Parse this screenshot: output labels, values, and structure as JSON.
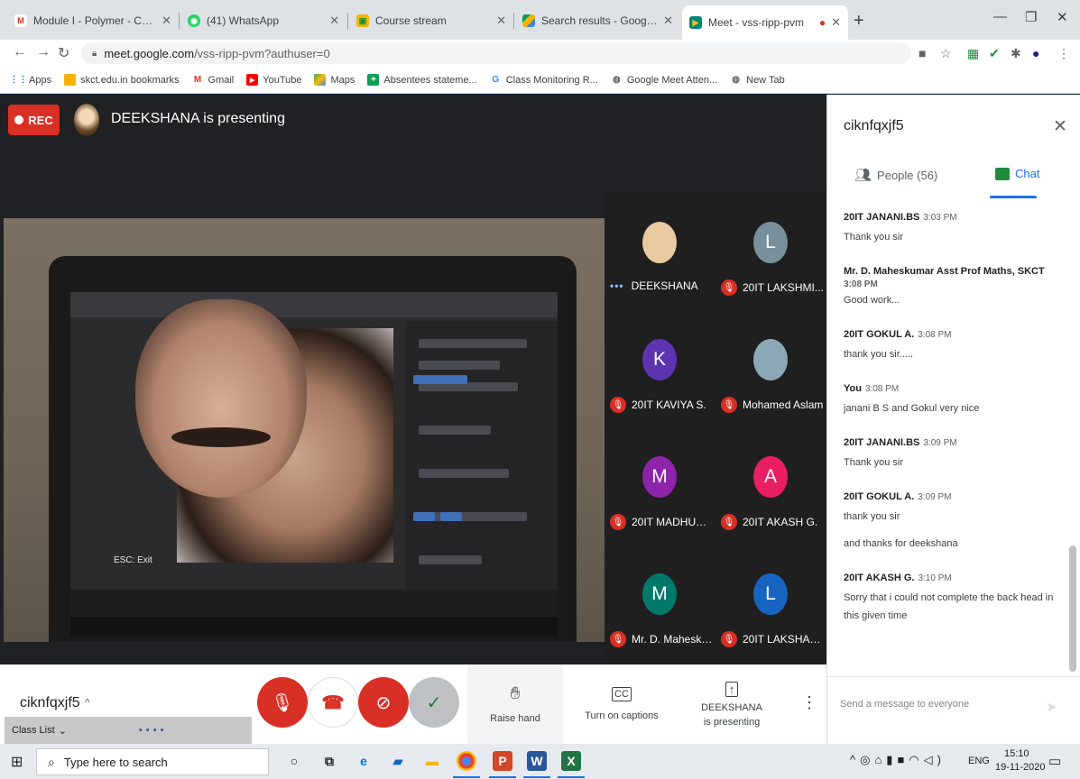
{
  "browser": {
    "tabs": [
      {
        "title": "Module I - Polymer - Corrected f",
        "icon": "gmail-icon"
      },
      {
        "title": "(41) WhatsApp",
        "icon": "whatsapp-icon"
      },
      {
        "title": "Course stream",
        "icon": "classroom-icon"
      },
      {
        "title": "Search results - Google Drive",
        "icon": "drive-icon"
      },
      {
        "title": "Meet - vss-ripp-pvm",
        "icon": "meet-icon"
      }
    ],
    "url_host": "meet.google.com",
    "url_path": "/vss-ripp-pvm?authuser=0",
    "bookmarks": [
      {
        "label": "Apps",
        "icon": "apps-grid-icon"
      },
      {
        "label": "skct.edu.in bookmarks",
        "icon": "folder-icon"
      },
      {
        "label": "Gmail",
        "icon": "gmail-icon"
      },
      {
        "label": "YouTube",
        "icon": "youtube-icon"
      },
      {
        "label": "Maps",
        "icon": "maps-icon"
      },
      {
        "label": "Absentees stateme...",
        "icon": "sheets-icon"
      },
      {
        "label": "Class Monitoring R...",
        "icon": "google-icon"
      },
      {
        "label": "Google Meet Atten...",
        "icon": "globe-icon"
      },
      {
        "label": "New Tab",
        "icon": "globe-icon"
      }
    ]
  },
  "meet": {
    "rec_label": "REC",
    "presenting_banner": "DEEKSHANA is presenting",
    "video_overlay_text": "ESC: Exit",
    "tiles": [
      {
        "name": "DEEKSHANA",
        "initial": "",
        "color": "#e8c9a0",
        "muted": false
      },
      {
        "name": "20IT LAKSHMI...",
        "initial": "L",
        "color": "#78909c",
        "muted": true
      },
      {
        "name": "20IT KAVIYA S.",
        "initial": "K",
        "color": "#5e35b1",
        "muted": true
      },
      {
        "name": "Mohamed Aslam",
        "initial": "",
        "color": "#8da9b8",
        "muted": true
      },
      {
        "name": "20IT MADHUMI...",
        "initial": "M",
        "color": "#8e24aa",
        "muted": true
      },
      {
        "name": "20IT AKASH G.",
        "initial": "A",
        "color": "#e91e63",
        "muted": true
      },
      {
        "name": "Mr. D. Mahesku...",
        "initial": "M",
        "color": "#00796b",
        "muted": true
      },
      {
        "name": "20IT LAKSHAN...",
        "initial": "L",
        "color": "#1565c0",
        "muted": true
      }
    ],
    "meeting_code": "ciknfqxjf5",
    "controls": {
      "raise_hand": "Raise hand",
      "captions": "Turn on captions",
      "presenting_1": "DEEKSHANA",
      "presenting_2": "is presenting"
    },
    "class_list_label": "Class List"
  },
  "panel": {
    "title": "ciknfqxjf5",
    "people_tab": "People (56)",
    "chat_tab": "Chat",
    "messages": [
      {
        "sender": "20IT JANANI.BS",
        "time": "3:03 PM",
        "text": "Thank you sir",
        "time_below": false
      },
      {
        "sender": "Mr. D. Maheskumar Asst Prof Maths, SKCT",
        "time": "3:08 PM",
        "text": "Good work...",
        "time_below": true
      },
      {
        "sender": "20IT GOKUL A.",
        "time": "3:08 PM",
        "text": "thank you sir.....",
        "time_below": false
      },
      {
        "sender": "You",
        "time": "3:08 PM",
        "text": "janani B S and Gokul very nice",
        "time_below": false
      },
      {
        "sender": "20IT JANANI.BS",
        "time": "3:09 PM",
        "text": "Thank you sir",
        "time_below": false
      },
      {
        "sender": "20IT GOKUL A.",
        "time": "3:09 PM",
        "text": "thank you sir",
        "time_below": false
      },
      {
        "sender": "",
        "time": "",
        "text": "and thanks for deekshana",
        "time_below": false
      },
      {
        "sender": "20IT AKASH G.",
        "time": "3:10 PM",
        "text": "Sorry that i could not complete the back head in this given time",
        "time_below": false
      }
    ],
    "input_placeholder": "Send a message to everyone"
  },
  "taskbar": {
    "search_placeholder": "Type here to search",
    "lang": "ENG",
    "time": "15:10",
    "date": "19-11-2020"
  },
  "colors": {
    "accent": "#1a73e8",
    "danger": "#d93025",
    "dark": "#202124"
  }
}
